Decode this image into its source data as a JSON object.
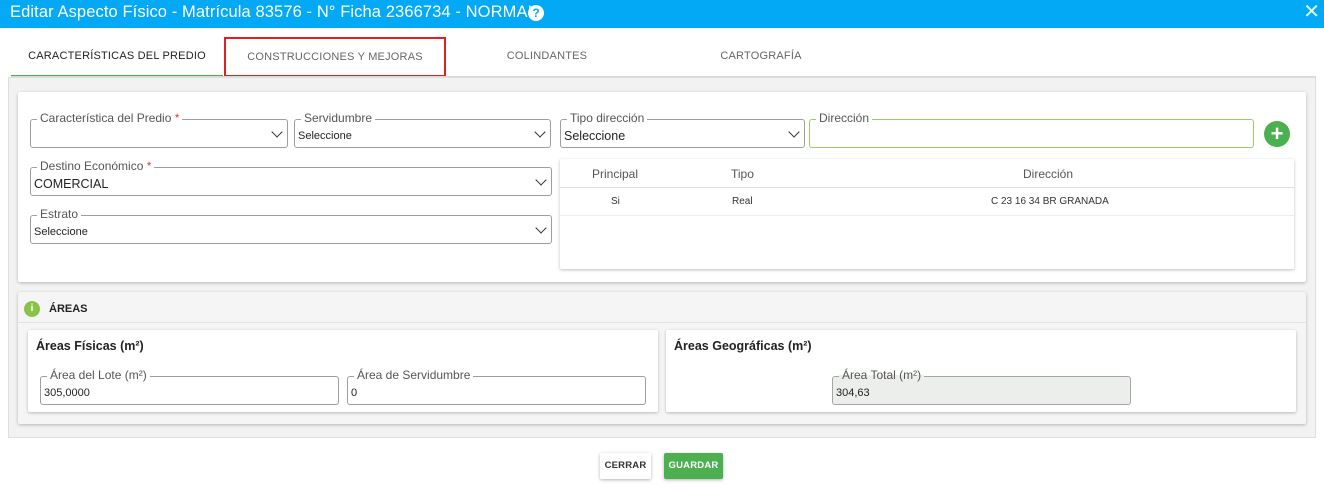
{
  "window": {
    "title": "Editar Aspecto Físico - Matrícula 83576 - N° Ficha 2366734 - NORMAL",
    "help_glyph": "?",
    "close_glyph": "✕"
  },
  "tabs": [
    {
      "label": "CARACTERÍSTICAS DEL PREDIO",
      "active": true
    },
    {
      "label": "CONSTRUCCIONES Y MEJORAS",
      "highlighted": true
    },
    {
      "label": "COLINDANTES"
    },
    {
      "label": "CARTOGRAFÍA"
    }
  ],
  "form": {
    "caracteristica": {
      "label": "Característica del Predio",
      "required": "*",
      "value": ""
    },
    "servidumbre": {
      "label": "Servidumbre",
      "value": "Seleccione"
    },
    "tipo_direccion": {
      "label": "Tipo dirección",
      "value": "Seleccione"
    },
    "direccion": {
      "label": "Dirección",
      "value": ""
    },
    "add_glyph": "+",
    "destino": {
      "label": "Destino Económico",
      "required": "*",
      "value": "COMERCIAL"
    },
    "estrato": {
      "label": "Estrato",
      "value": "Seleccione"
    }
  },
  "address_table": {
    "headers": [
      "Principal",
      "Tipo",
      "Dirección"
    ],
    "rows": [
      [
        "Si",
        "Real",
        "C 23 16 34 BR GRANADA"
      ]
    ]
  },
  "areas": {
    "title": "ÁREAS",
    "info_glyph": "i",
    "fisicas": {
      "title": "Áreas Físicas (m²)",
      "lote": {
        "label": "Área del Lote (m²)",
        "value": "305,0000"
      },
      "servidumbre": {
        "label": "Área de Servidumbre",
        "value": "0"
      }
    },
    "geograficas": {
      "title": "Áreas Geográficas (m²)",
      "total": {
        "label": "Área Total (m²)",
        "value": "304,63"
      }
    }
  },
  "buttons": {
    "cerrar": "CERRAR",
    "guardar": "GUARDAR"
  },
  "colors": {
    "titlebar": "#03a9f4",
    "accent_green": "#4caf50",
    "tab_highlight_border": "#e0201f"
  }
}
